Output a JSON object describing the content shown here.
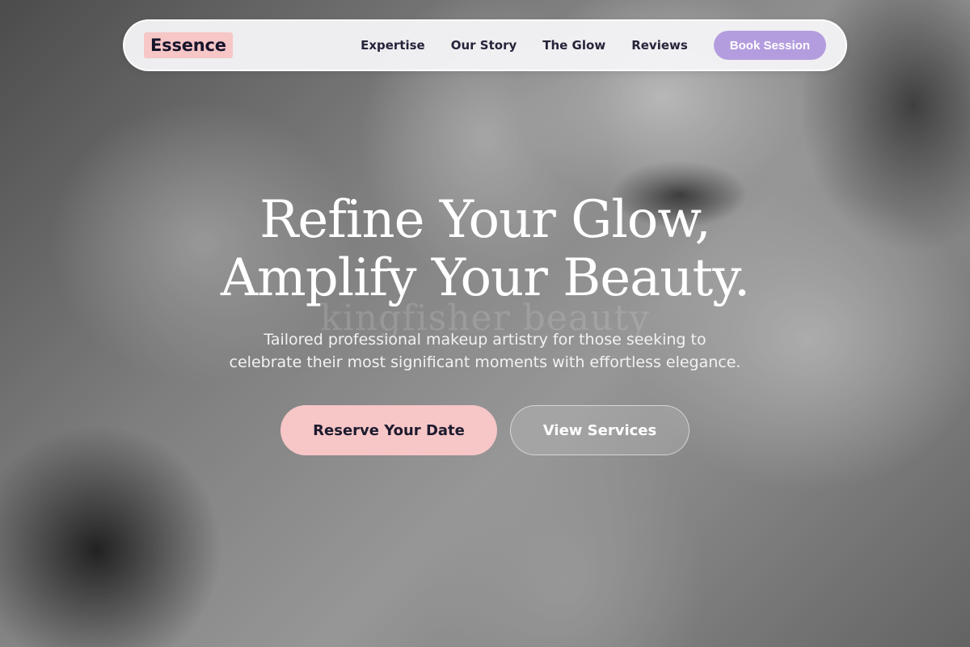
{
  "nav": {
    "logo": "Essence",
    "links": [
      "Expertise",
      "Our Story",
      "The Glow",
      "Reviews"
    ],
    "cta": "Book Session"
  },
  "hero": {
    "title_line1": "Refine Your Glow,",
    "title_line2": "Amplify Your Beauty.",
    "watermark": "kingfisher beauty",
    "subtitle_line1": "Tailored professional makeup artistry for those seeking to",
    "subtitle_line2": "celebrate their most significant moments with effortless elegance.",
    "primary_button": "Reserve Your Date",
    "secondary_button": "View Services"
  },
  "colors": {
    "logo_bg": "#f7c6c7",
    "cta_bg": "#b49ddf",
    "primary_button_bg": "#f7c6c7",
    "text_dark": "#26243a"
  }
}
